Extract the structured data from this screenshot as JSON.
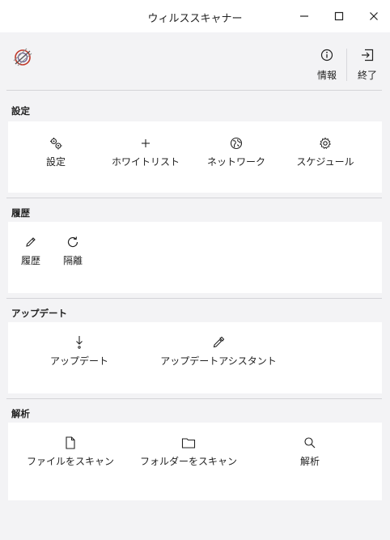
{
  "window": {
    "title": "ウィルススキャナー",
    "controls": {
      "minimize_icon": "minimize-icon",
      "maximize_icon": "maximize-icon",
      "close_icon": "close-icon"
    }
  },
  "toolbar": {
    "logo_icon": "app-logo-icon",
    "info_label": "情報",
    "info_icon": "info-icon",
    "exit_label": "終了",
    "exit_icon": "exit-icon"
  },
  "sections": {
    "settings": {
      "title": "設定",
      "items": [
        {
          "label": "設定",
          "icon": "gears-icon"
        },
        {
          "label": "ホワイトリスト",
          "icon": "plus-icon"
        },
        {
          "label": "ネットワーク",
          "icon": "globe-icon"
        },
        {
          "label": "スケジュール",
          "icon": "gear-icon"
        }
      ]
    },
    "history": {
      "title": "履歴",
      "items": [
        {
          "label": "履歴",
          "icon": "pencil-icon"
        },
        {
          "label": "隔離",
          "icon": "refresh-icon"
        }
      ]
    },
    "update": {
      "title": "アップデート",
      "items": [
        {
          "label": "アップデート",
          "icon": "download-arrow-icon"
        },
        {
          "label": "アップデートアシスタント",
          "icon": "eyedropper-icon"
        }
      ]
    },
    "analysis": {
      "title": "解析",
      "items": [
        {
          "label": "ファイルをスキャン",
          "icon": "file-icon"
        },
        {
          "label": "フォルダーをスキャン",
          "icon": "folder-icon"
        },
        {
          "label": "解析",
          "icon": "search-icon"
        }
      ]
    }
  },
  "colors": {
    "background": "#f3f3f5",
    "panel": "#ffffff",
    "logo_accent": "#c0392b"
  }
}
